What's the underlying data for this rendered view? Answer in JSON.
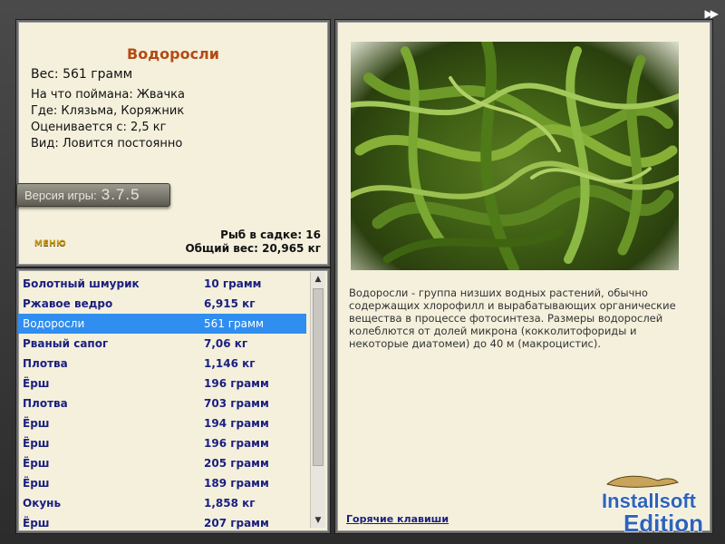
{
  "info": {
    "title": "Водоросли",
    "weight_line": "Вес: 561 грамм",
    "facts": [
      "На что поймана: Жвачка",
      "Где: Клязьма, Коряжник",
      "Оценивается с: 2,5 кг",
      "Вид: Ловится постоянно"
    ],
    "version_label": "Версия игры:",
    "version_number": "3.7.5",
    "menu_link": "МЕНЮ",
    "fish_in_keepnet": "Рыб в садке: 16",
    "total_weight": "Общий вес: 20,965 кг"
  },
  "catch_list": [
    {
      "name": "Болотный шмурик",
      "weight": "10 грамм",
      "selected": false
    },
    {
      "name": "Ржавое ведро",
      "weight": "6,915 кг",
      "selected": false
    },
    {
      "name": "Водоросли",
      "weight": "561 грамм",
      "selected": true
    },
    {
      "name": "Рваный сапог",
      "weight": "7,06 кг",
      "selected": false
    },
    {
      "name": "Плотва",
      "weight": "1,146 кг",
      "selected": false
    },
    {
      "name": "Ёрш",
      "weight": "196 грамм",
      "selected": false
    },
    {
      "name": "Плотва",
      "weight": "703 грамм",
      "selected": false
    },
    {
      "name": "Ёрш",
      "weight": "194 грамм",
      "selected": false
    },
    {
      "name": "Ёрш",
      "weight": "196 грамм",
      "selected": false
    },
    {
      "name": "Ёрш",
      "weight": "205 грамм",
      "selected": false
    },
    {
      "name": "Ёрш",
      "weight": "189 грамм",
      "selected": false
    },
    {
      "name": "Окунь",
      "weight": "1,858 кг",
      "selected": false
    },
    {
      "name": "Ёрш",
      "weight": "207 грамм",
      "selected": false
    }
  ],
  "detail": {
    "description": "Водоросли - группа низших водных растений, обычно содержащих хлорофилл и вырабатывающих органические вещества в процессе фотосинтеза. Размеры водорослей колеблются от долей микрона (кокколитофориды и некоторые диатомеи) до 40 м (макроцистис).",
    "hotkeys_link": "Горячие клавиши"
  },
  "logo": {
    "line1": "Installsoft",
    "line2": "Edition"
  },
  "icons": {
    "forward": "fast-forward-icon",
    "scroll_up": "chevron-up-icon",
    "scroll_down": "chevron-down-icon"
  },
  "colors": {
    "title": "#b44a14",
    "list_text": "#1a1f80",
    "selection": "#2f8ef0",
    "panel_bg": "#f4f0dc"
  }
}
